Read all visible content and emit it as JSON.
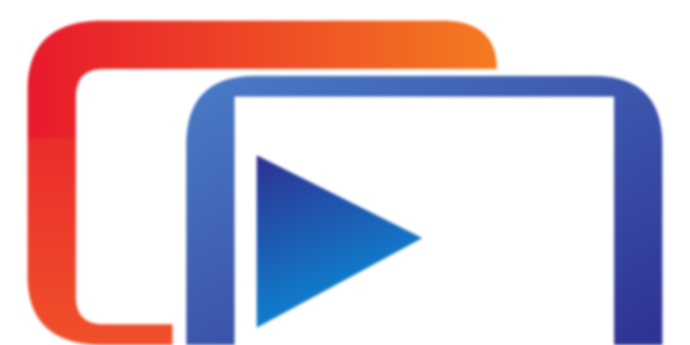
{
  "app": {
    "icon_name": "video-player-app-icon",
    "colors": {
      "back_frame_start": "#e8192c",
      "back_frame_end": "#f47b20",
      "front_frame_start": "#4a7cc7",
      "front_frame_end": "#2e3192",
      "play_start": "#2e3192",
      "play_end": "#0a8ad6",
      "background": "#ffffff"
    }
  }
}
